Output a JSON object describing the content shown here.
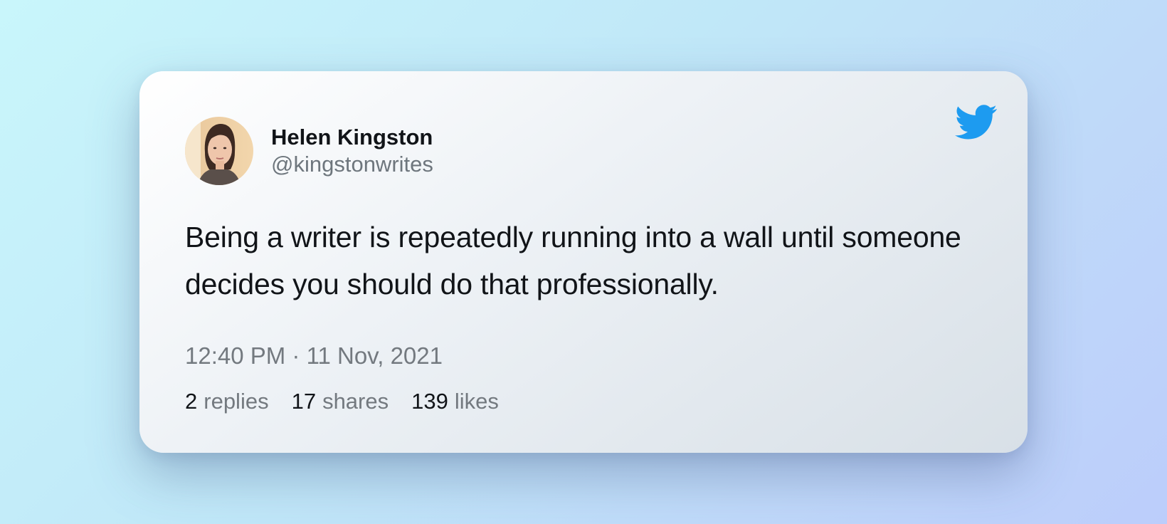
{
  "colors": {
    "background_gradient": [
      "#c9f6fb",
      "#c0e7f8",
      "#bfd8f9",
      "#bccdfb"
    ],
    "twitter_blue": "#1d9bf0",
    "text_primary": "#111418",
    "text_secondary": "#73797f"
  },
  "tweet": {
    "author": {
      "display_name": "Helen Kingston",
      "handle": "@kingstonwrites",
      "avatar_icon": "profile-photo"
    },
    "brand_icon": "twitter-bird-icon",
    "text": "Being a writer is repeatedly running into a wall until someone decides you should do that professionally.",
    "timestamp": "12:40 PM · 11 Nov, 2021",
    "stats": [
      {
        "count": "2",
        "label": "replies"
      },
      {
        "count": "17",
        "label": "shares"
      },
      {
        "count": "139",
        "label": "likes"
      }
    ]
  }
}
